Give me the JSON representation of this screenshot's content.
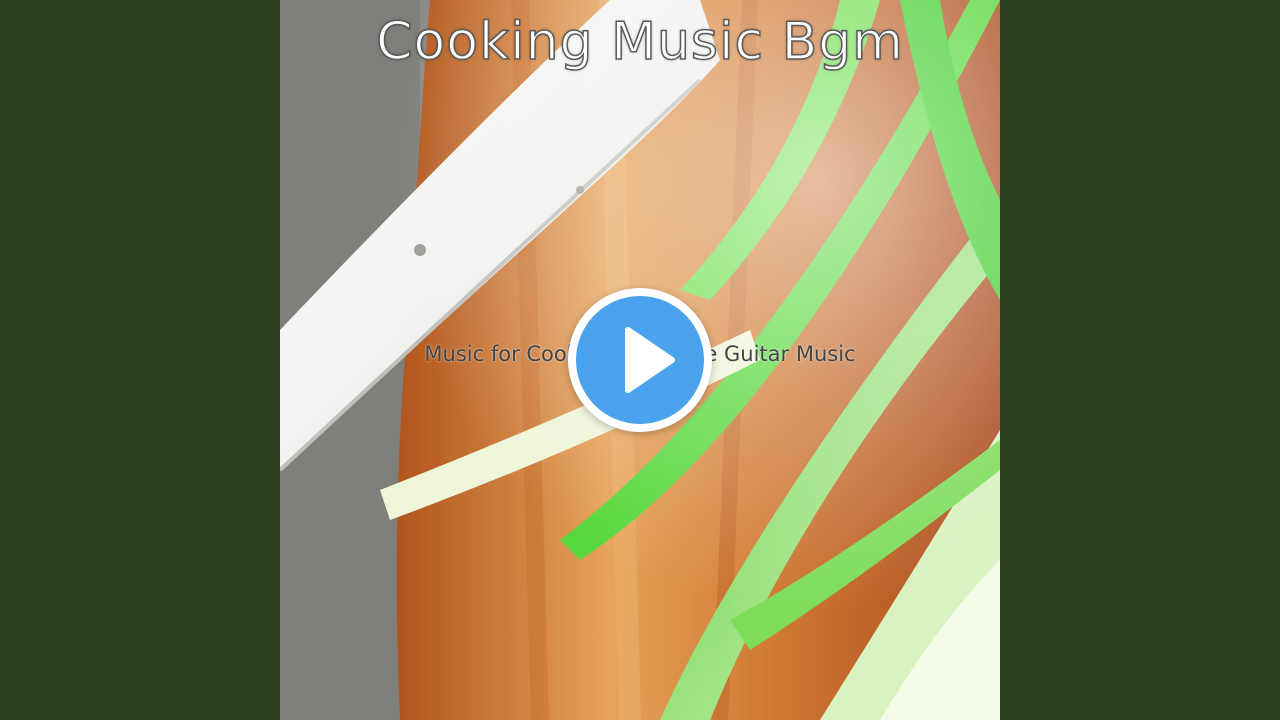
{
  "video": {
    "title": "Cooking Music Bgm",
    "subtitle": "Music for Cooking - Sublime Guitar Music"
  },
  "player": {
    "play_icon": "play-icon"
  },
  "colors": {
    "side_background": "#2b3f1f",
    "play_button_accent": "#4aa3ec"
  }
}
